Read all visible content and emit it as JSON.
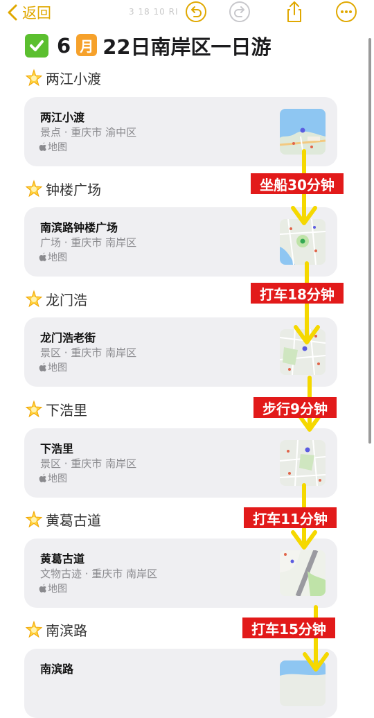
{
  "nav": {
    "back_label": "返回",
    "status_ghost": "3 18 10 RI"
  },
  "title": {
    "prefix": "6",
    "month_icon_char": "月",
    "rest": "22日南岸区一日游"
  },
  "sections": [
    {
      "header": "两江小渡",
      "card": {
        "name": "两江小渡",
        "subtitle": "景点 · 重庆市 渝中区",
        "app": "地图"
      }
    },
    {
      "header": "钟楼广场",
      "card": {
        "name": "南滨路钟楼广场",
        "subtitle": "广场 · 重庆市 南岸区",
        "app": "地图"
      }
    },
    {
      "header": "龙门浩",
      "card": {
        "name": "龙门浩老街",
        "subtitle": "景区 · 重庆市 南岸区",
        "app": "地图"
      }
    },
    {
      "header": "下浩里",
      "card": {
        "name": "下浩里",
        "subtitle": "景区 · 重庆市 南岸区",
        "app": "地图"
      }
    },
    {
      "header": "黄葛古道",
      "card": {
        "name": "黄葛古道",
        "subtitle": "文物古迹 · 重庆市 南岸区",
        "app": "地图"
      }
    },
    {
      "header": "南滨路",
      "card": {
        "name": "南滨路",
        "subtitle": "",
        "app": ""
      }
    }
  ],
  "routes": [
    "坐船30分钟",
    "打车18分钟",
    "步行9分钟",
    "打车11分钟",
    "打车15分钟"
  ],
  "colors": {
    "accent": "#e0a800",
    "route_arrow": "#f5d800",
    "route_label_bg": "#e21a1a",
    "card_bg": "#efeff2"
  },
  "icons": [
    "chevron-left-icon",
    "undo-icon",
    "redo-icon",
    "share-icon",
    "more-icon",
    "checkmark-icon",
    "calendar-icon",
    "star-icon",
    "apple-icon",
    "map-thumbnail"
  ]
}
